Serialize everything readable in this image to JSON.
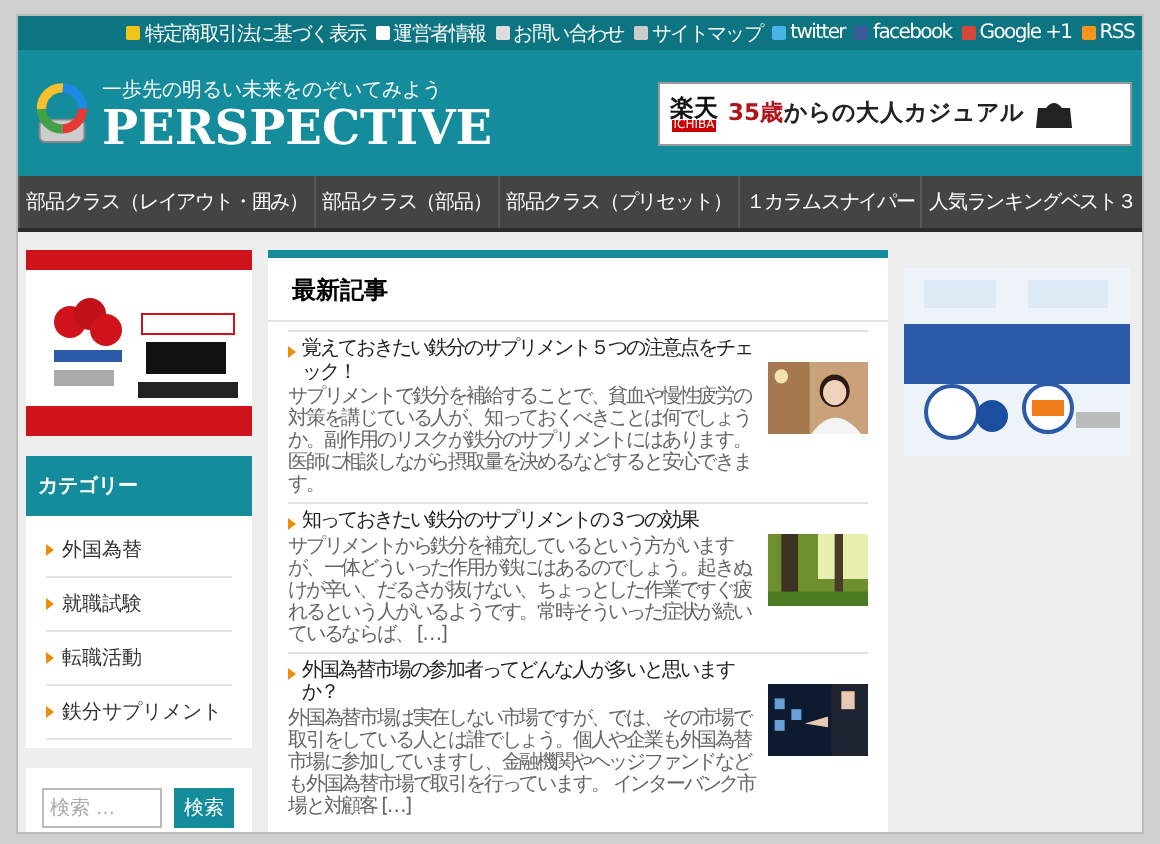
{
  "top_links": [
    {
      "label": "特定商取引法に基づく表示"
    },
    {
      "label": "運営者情報"
    },
    {
      "label": "お問い合わせ"
    },
    {
      "label": "サイトマップ"
    },
    {
      "label": "twitter"
    },
    {
      "label": "facebook"
    },
    {
      "label": "Google +1"
    },
    {
      "label": "RSS"
    }
  ],
  "header": {
    "tagline": "一歩先の明るい未来をのぞいてみよう",
    "logo": "PERSPECTIVE",
    "banner": {
      "brand": "楽天",
      "brand_sub": "ICHIBA",
      "highlight": "35歳",
      "text": "からの大人カジュアル"
    }
  },
  "nav": [
    "部品クラス（レイアウト・囲み）",
    "部品クラス（部品）",
    "部品クラス（プリセット）",
    "１カラムスナイパー",
    "人気ランキングベスト３"
  ],
  "categories": {
    "title": "カテゴリー",
    "items": [
      "外国為替",
      "就職試験",
      "転職活動",
      "鉄分サプリメント"
    ]
  },
  "search": {
    "placeholder": "検索 …",
    "button": "検索"
  },
  "latest": {
    "title": "最新記事",
    "articles": [
      {
        "title": "覚えておきたい鉄分のサプリメント５つの注意点をチェック！",
        "excerpt": "サプリメントで鉄分を補給することで、貧血や慢性疲労の対策を講じている人が、知っておくべきことは何でしょうか。副作用のリスクが鉄分のサプリメントにはあります。医師に相談しながら摂取量を決めるなどすると安心できます。"
      },
      {
        "title": "知っておきたい鉄分のサプリメントの３つの効果",
        "excerpt": "サプリメントから鉄分を補充しているという方がいますが、一体どういった作用が鉄にはあるのでしょう。起きぬけが辛い、だるさが抜けない、ちょっとした作業ですぐ疲れるという人がいるようです。常時そういった症状が続いているならば、 […]"
      },
      {
        "title": "外国為替市場の参加者ってどんな人が多いと思いますか？",
        "excerpt": "外国為替市場は実在しない市場ですが、では、その市場で取引をしている人とは誰でしょう。個人や企業も外国為替市場に参加していますし、金融機関やヘッジファンドなども外国為替市場で取引を行っています。 インターバンク市場と対顧客 […]"
      }
    ]
  }
}
